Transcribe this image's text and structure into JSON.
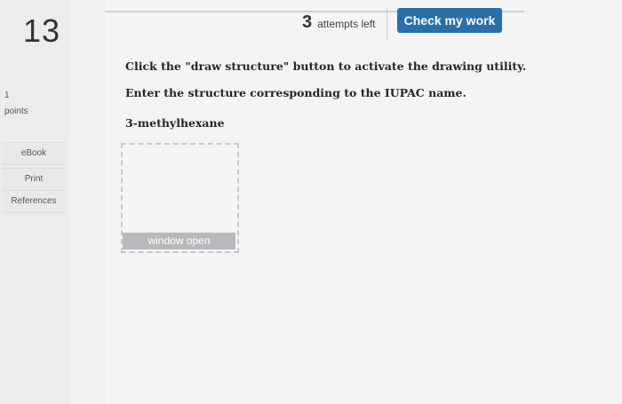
{
  "question": {
    "number": "13",
    "points_value": "1",
    "points_label": "points"
  },
  "sidebar": {
    "buttons": [
      {
        "label": "eBook"
      },
      {
        "label": "Print"
      },
      {
        "label": "References"
      }
    ]
  },
  "header": {
    "attempts_count": "3",
    "attempts_label": "attempts left",
    "check_button_label": "Check my work"
  },
  "content": {
    "instruction_1": "Click the \"draw structure\" button to activate the drawing utility.",
    "instruction_2": "Enter the structure corresponding to the IUPAC name.",
    "compound_name": "3-methylhexane",
    "drawing_button_label": "window open"
  },
  "colors": {
    "check_button_bg": "#2b6ea8",
    "window_open_bg": "#b9b9bd"
  }
}
